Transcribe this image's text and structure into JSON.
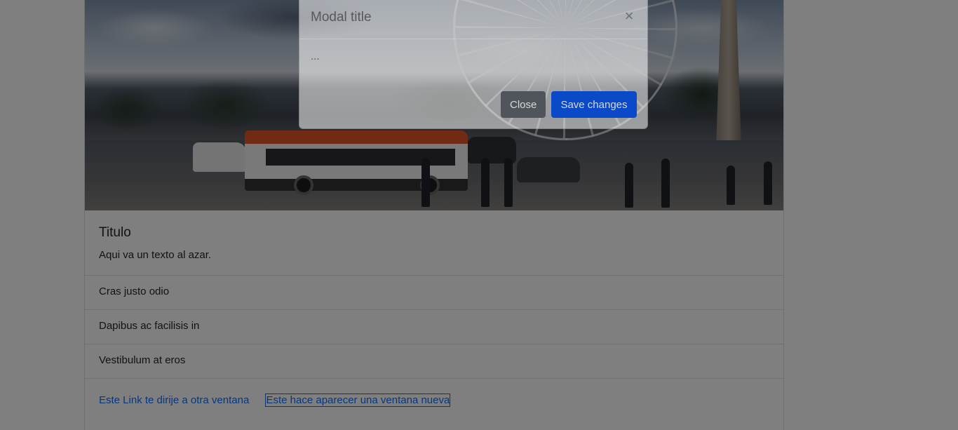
{
  "card": {
    "title": "Titulo",
    "text": "Aqui va un texto al azar.",
    "list_items": [
      "Cras justo odio",
      "Dapibus ac facilisis in",
      "Vestibulum at eros"
    ],
    "links": [
      "Este Link te dirije a otra ventana",
      "Este hace aparecer una ventana nueva"
    ]
  },
  "modal": {
    "title": "Modal title",
    "close_icon": "×",
    "body": "...",
    "close_label": "Close",
    "save_label": "Save changes"
  },
  "colors": {
    "primary": "#0d6efd",
    "secondary": "#6c757d",
    "backdrop": "rgba(0,0,0,0.5)"
  }
}
